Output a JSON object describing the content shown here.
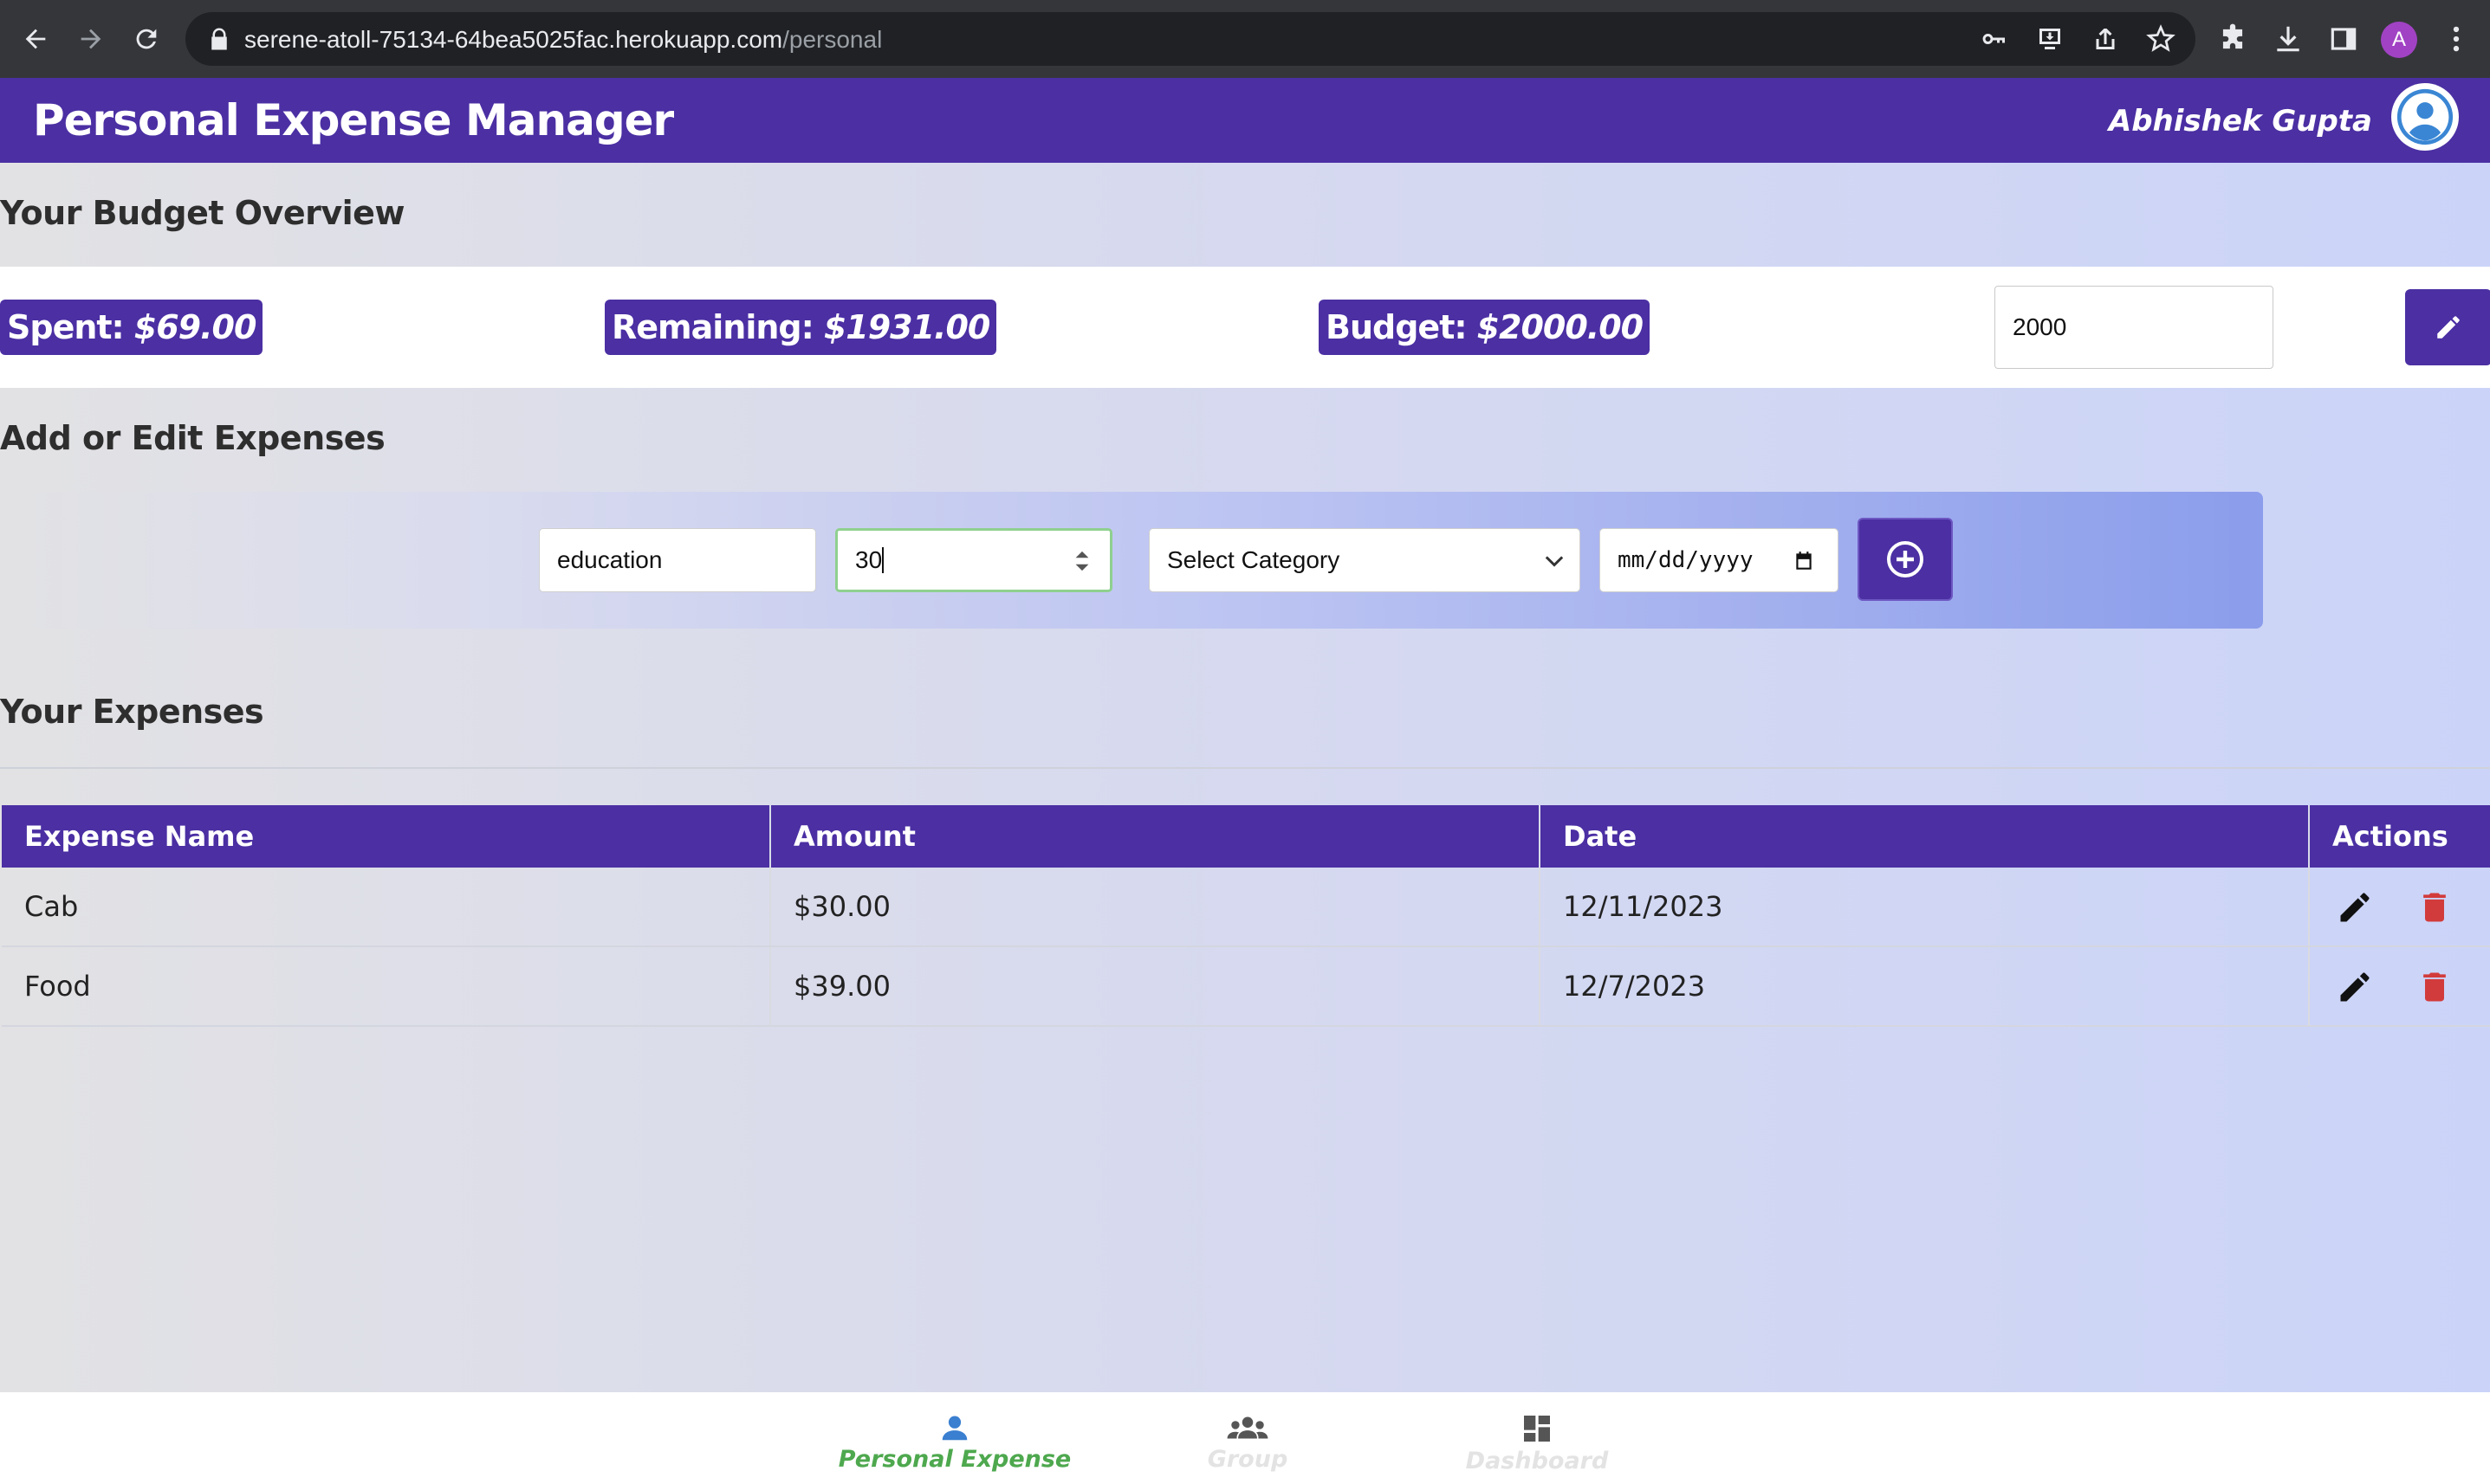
{
  "browser": {
    "url_host": "serene-atoll-75134-64bea5025fac.herokuapp.com",
    "url_path": "/personal",
    "profile_initial": "A",
    "icons": [
      "back-icon",
      "forward-icon",
      "reload-icon",
      "lock-icon",
      "key-icon",
      "install-icon",
      "share-icon",
      "star-icon",
      "extensions-icon",
      "download-icon",
      "side-panel-icon",
      "menu-icon"
    ]
  },
  "header": {
    "title": "Personal Expense Manager",
    "user_name": "Abhishek Gupta",
    "brand_color": "#4b2fa3"
  },
  "budget": {
    "section_title": "Your Budget Overview",
    "spent_label": "Spent:",
    "spent_value": "$69.00",
    "remaining_label": "Remaining:",
    "remaining_value": "$1931.00",
    "budget_label": "Budget:",
    "budget_value": "$2000.00",
    "input_value": "2000"
  },
  "form": {
    "section_title": "Add or Edit Expenses",
    "name_value": "education",
    "amount_value": "30",
    "category_value": "Select Category",
    "date_placeholder": "mm/dd/yyyy"
  },
  "expenses": {
    "section_title": "Your Expenses",
    "columns": [
      "Expense Name",
      "Amount",
      "Date",
      "Actions"
    ],
    "rows": [
      {
        "name": "Cab",
        "amount": "$30.00",
        "date": "12/11/2023"
      },
      {
        "name": "Food",
        "amount": "$39.00",
        "date": "12/7/2023"
      }
    ]
  },
  "bottom_nav": {
    "items": [
      {
        "label": "Personal Expense",
        "icon": "person-icon",
        "active": true
      },
      {
        "label": "Group",
        "icon": "group-icon",
        "active": false
      },
      {
        "label": "Dashboard",
        "icon": "dashboard-icon",
        "active": false
      }
    ],
    "active_color": "#4ea84e"
  }
}
